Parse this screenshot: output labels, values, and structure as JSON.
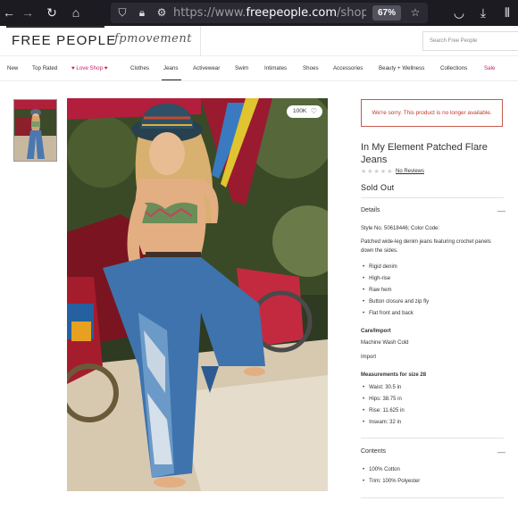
{
  "browser": {
    "url_scheme": "https://www.",
    "url_domain": "freepeople.com",
    "url_path": "/shop/in-my-ele",
    "zoom": "67%"
  },
  "header": {
    "logo": "FREE PEOPLE",
    "sub_brand": "fpmovement",
    "search_placeholder": "Search Free People"
  },
  "nav": [
    {
      "label": "New"
    },
    {
      "label": "Top Rated"
    },
    {
      "label": "Love Shop"
    },
    {
      "label": "Clothes"
    },
    {
      "label": "Jeans"
    },
    {
      "label": "Activewear"
    },
    {
      "label": "Swim"
    },
    {
      "label": "Intimates"
    },
    {
      "label": "Shoes"
    },
    {
      "label": "Accessories"
    },
    {
      "label": "Beauty + Wellness"
    },
    {
      "label": "Collections"
    },
    {
      "label": "Sale"
    }
  ],
  "gallery": {
    "favorites": "100K"
  },
  "product": {
    "error": "We're sorry. This product is no longer available.",
    "title": "In My Element Patched Flare Jeans",
    "reviews": "No Reviews",
    "status": "Sold Out",
    "details_label": "Details",
    "style": "Style No. 50618446; Color Code:",
    "description": "Patched wide-leg denim jeans featuring crochet panels down the sides.",
    "features": [
      "Rigid denim",
      "High-rise",
      "Raw hem",
      "Button closure and zip fly",
      "Flat front and back"
    ],
    "care_label": "Care/Import",
    "care": "Machine Wash Cold",
    "import": "Import",
    "measure_label": "Measurements for size 28",
    "measurements": [
      "Waist: 30.5 in",
      "Hips: 38.75 in",
      "Rise: 11.625 in",
      "Inseam: 32 in"
    ],
    "contents_label": "Contents",
    "contents": [
      "100% Cotton",
      "Trim: 100% Polyester"
    ]
  },
  "colors": {
    "error": "#c0392b",
    "sale": "#c0246b",
    "chrome": "#1c1b22"
  }
}
